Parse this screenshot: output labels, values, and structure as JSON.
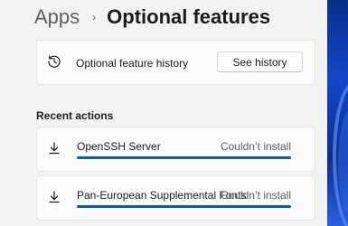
{
  "breadcrumb": {
    "parent": "Apps",
    "separator": "›",
    "current": "Optional features"
  },
  "history_card": {
    "icon": "history-icon",
    "label": "Optional feature history",
    "button_label": "See history"
  },
  "recent_actions": {
    "title": "Recent actions",
    "items": [
      {
        "icon": "download-icon",
        "name": "OpenSSH Server",
        "status": "Couldn’t install",
        "progress": 1.0
      },
      {
        "icon": "download-icon",
        "name": "Pan-European Supplemental Fonts",
        "status": "Couldn’t install",
        "progress": 1.0
      }
    ]
  },
  "colors": {
    "accent": "#005fb8",
    "background": "#f3f3f3",
    "card": "#fbfbfb"
  }
}
